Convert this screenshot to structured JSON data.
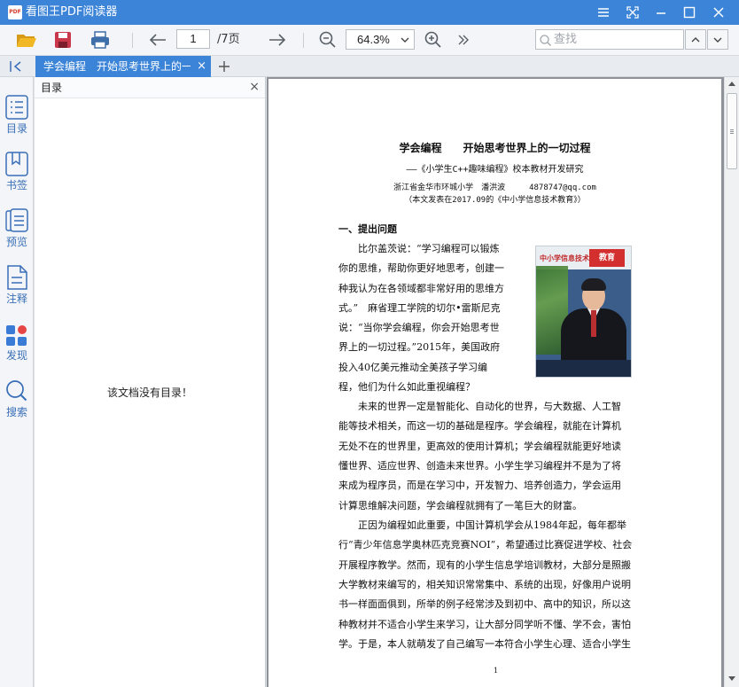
{
  "app": {
    "title": "看图王PDF阅读器",
    "logo_text": "PDF"
  },
  "toolbar": {
    "page_current": "1",
    "page_total": "/7页",
    "zoom": "64.3%",
    "search_placeholder": "查找"
  },
  "tab": {
    "label": "学会编程　开始思考世界上的一切过程",
    "close": "×",
    "add": "+"
  },
  "rail": {
    "items": [
      {
        "label": "目录",
        "icon": "outline-icon"
      },
      {
        "label": "书签",
        "icon": "bookmark-icon"
      },
      {
        "label": "预览",
        "icon": "thumbnail-icon"
      },
      {
        "label": "注释",
        "icon": "annotation-icon"
      },
      {
        "label": "发现",
        "icon": "discover-icon"
      },
      {
        "label": "搜索",
        "icon": "search-icon"
      }
    ]
  },
  "panel": {
    "title": "目录",
    "close": "×",
    "empty_text": "该文档没有目录！"
  },
  "document": {
    "title": "学会编程　　开始思考世界上的一切过程",
    "subtitle": "——《小学生C++趣味编程》校本教材开发研究",
    "author": "浙江省金华市环城小学　潘洪波　　　4878747@qq.com",
    "note": "（本文发表在2017.09的《中小学信息技术教育》）",
    "section1": "一、提出问题",
    "wrap_lines": [
      "　　比尔盖茨说：“学习编程可以锻炼",
      "你的思维，帮助你更好地思考，创建一",
      "种我认为在各领域都非常好用的思维方",
      "式。”　麻省理工学院的切尔•雷斯尼克",
      "说：“当你学会编程，你会开始思考世",
      "界上的一切过程。”2015年，美国政府",
      "投入40亿美元推动全美孩子学习编",
      "程，他们为什么如此重视编程？"
    ],
    "full_lines": [
      "　　未来的世界一定是智能化、自动化的世界，与大数据、人工智",
      "能等技术相关，而这一切的基础是程序。学会编程，就能在计算机",
      "无处不在的世界里，更高效的使用计算机；学会编程就能更好地读",
      "懂世界、适应世界、创造未来世界。小学生学习编程并不是为了将",
      "来成为程序员，而是在学习中，开发智力、培养创造力，学会运用",
      "计算思维解决问题，学会编程就拥有了一笔巨大的财富。",
      "　　正因为编程如此重要，中国计算机学会从1984年起，每年都举",
      "行“青少年信息学奥林匹克竞赛NOI”，希望通过比赛促进学校、社会",
      "开展程序教学。然而，现有的小学生信息学培训教材，大部分是照搬",
      "大学教材来编写的，相关知识常常集中、系统的出现，好像用户说明",
      "书一样面面俱到，所举的例子经常涉及到初中、高中的知识，所以这",
      "种教材并不适合小学生来学习，让大部分同学听不懂、学不会，害怕",
      "学。于是，本人就萌发了自己编写一本符合小学生心理、适合小学生"
    ],
    "page_number": "1",
    "cover": {
      "masthead": "中小学信息技术",
      "brand": "教育"
    }
  },
  "colors": {
    "accent": "#3c84d8",
    "rail_label": "#3a6fb7",
    "toolbar_bg": "#f3f5f8"
  }
}
